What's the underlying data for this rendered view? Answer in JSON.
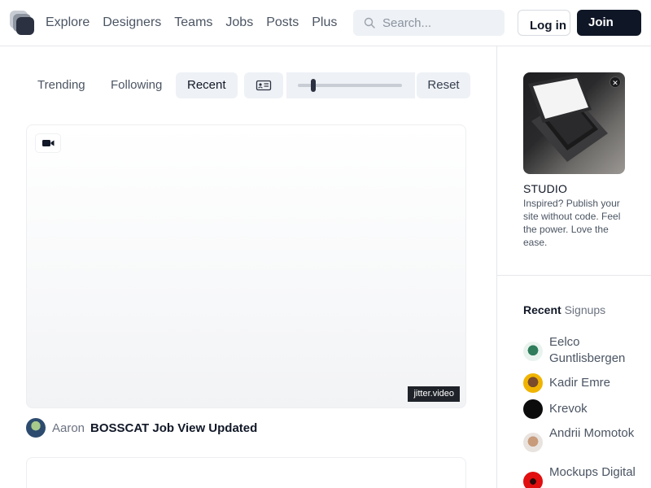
{
  "header": {
    "nav": [
      "Explore",
      "Designers",
      "Teams",
      "Jobs",
      "Posts",
      "Plus"
    ],
    "search_placeholder": "Search...",
    "login_label": "Log in",
    "join_label": "Join"
  },
  "filters": {
    "tabs": [
      "Trending",
      "Following",
      "Recent"
    ],
    "active_tab": "Recent",
    "reset_label": "Reset"
  },
  "post": {
    "watermark": "jitter.video",
    "author": "Aaron",
    "title": "BOSSCAT Job View Updated"
  },
  "sidebar": {
    "ad": {
      "title": "STUDIO",
      "text": "Inspired? Publish your site without code. Feel the power. Love the ease."
    },
    "signups_heading_bold": "Recent",
    "signups_heading_rest": "Signups",
    "signups": [
      {
        "name": "Eelco Guntlisbergen"
      },
      {
        "name": "Kadir Emre"
      },
      {
        "name": "Krevok"
      },
      {
        "name": "Andrii Momotok"
      },
      {
        "name": "Mockups Digital"
      }
    ]
  },
  "colors": {
    "primary_dark": "#0f1626",
    "pill_bg": "#eef1f5"
  }
}
